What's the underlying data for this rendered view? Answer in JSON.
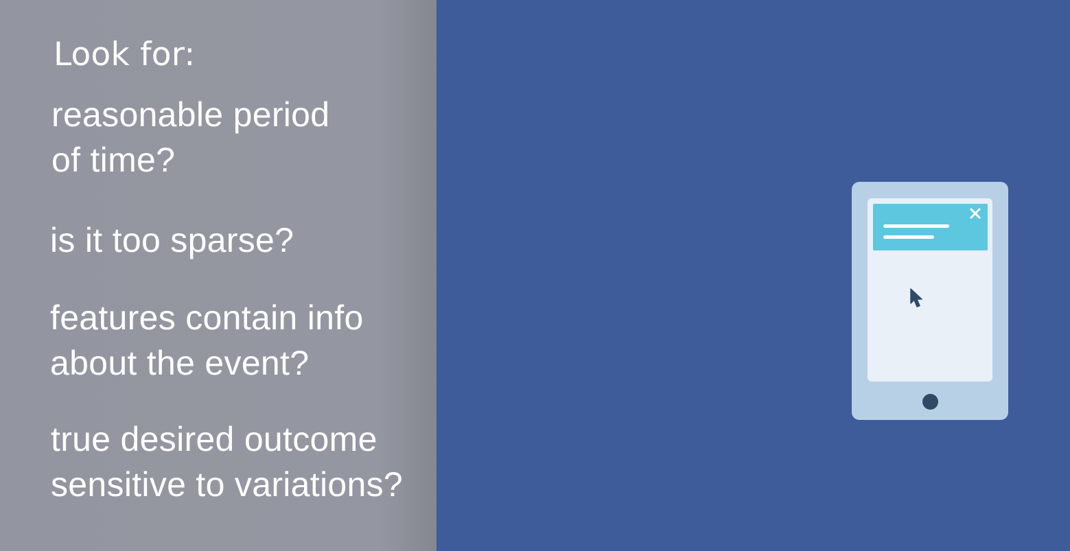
{
  "slide": {
    "heading": "Look for:",
    "items": [
      {
        "lines": [
          "reasonable period",
          "of time?"
        ]
      },
      {
        "lines": [
          "is it too sparse?"
        ]
      },
      {
        "lines": [
          "features contain info",
          "about the event?"
        ]
      },
      {
        "lines": [
          "true desired outcome",
          "sensitive to variations?"
        ]
      }
    ]
  },
  "illustration": {
    "device": "tablet",
    "icons": [
      "close-icon",
      "cursor-icon"
    ]
  },
  "colors": {
    "left_panel_bg": "#9497a1",
    "right_panel_bg": "#3d5c99",
    "text": "#ffffff",
    "tablet_frame": "#b8d0e6",
    "tablet_screen": "#e9f0f8",
    "notification_bg": "#5ec7e0",
    "dark_accent": "#2e4a66"
  }
}
